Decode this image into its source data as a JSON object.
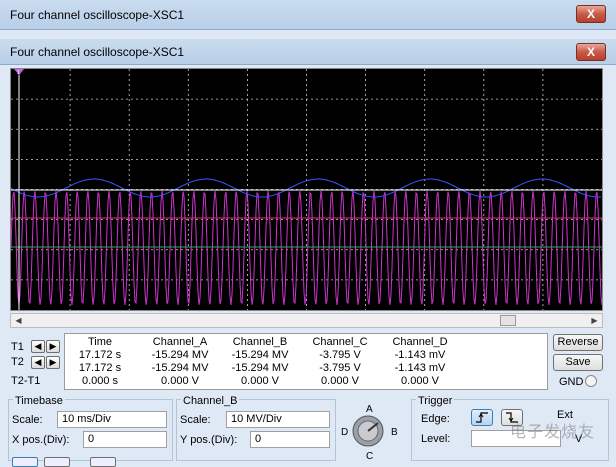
{
  "window": {
    "outer_title": "Four channel oscilloscope-XSC1",
    "inner_title": "Four channel oscilloscope-XSC1",
    "close_label": "X"
  },
  "scope": {
    "background": "#000000",
    "grid_color": "#cccccc",
    "colors": {
      "channel_a": "#cc33cc",
      "channel_b": "#3355ff",
      "channel_c": "#dd3366",
      "channel_d": "#33aa55",
      "cursor": "#ffffff"
    },
    "cursor_marker_1": "1",
    "cursor_marker_2": "2"
  },
  "readout": {
    "row_labels": [
      "T1",
      "T2",
      "T2-T1"
    ],
    "headers": [
      "Time",
      "Channel_A",
      "Channel_B",
      "Channel_C",
      "Channel_D"
    ],
    "rows": [
      [
        "17.172 s",
        "-15.294 MV",
        "-15.294 MV",
        "-3.795 V",
        "-1.143 mV"
      ],
      [
        "17.172 s",
        "-15.294 MV",
        "-15.294 MV",
        "-3.795 V",
        "-1.143 mV"
      ],
      [
        "0.000 s",
        "0.000 V",
        "0.000 V",
        "0.000 V",
        "0.000 V"
      ]
    ]
  },
  "buttons": {
    "reverse": "Reverse",
    "save": "Save",
    "gnd": "GND"
  },
  "timebase": {
    "group": "Timebase",
    "scale_label": "Scale:",
    "scale_value": "10 ms/Div",
    "xpos_label": "X pos.(Div):",
    "xpos_value": "0"
  },
  "channel": {
    "group": "Channel_B",
    "scale_label": "Scale:",
    "scale_value": "10 MV/Div",
    "ypos_label": "Y pos.(Div):",
    "ypos_value": "0"
  },
  "selector": {
    "a": "A",
    "b": "B",
    "c": "C",
    "d": "D"
  },
  "trigger": {
    "group": "Trigger",
    "edge_label": "Edge:",
    "level_label": "Level:",
    "ext_label": "Ext",
    "level_value": "V"
  },
  "watermark": "电子发烧友"
}
